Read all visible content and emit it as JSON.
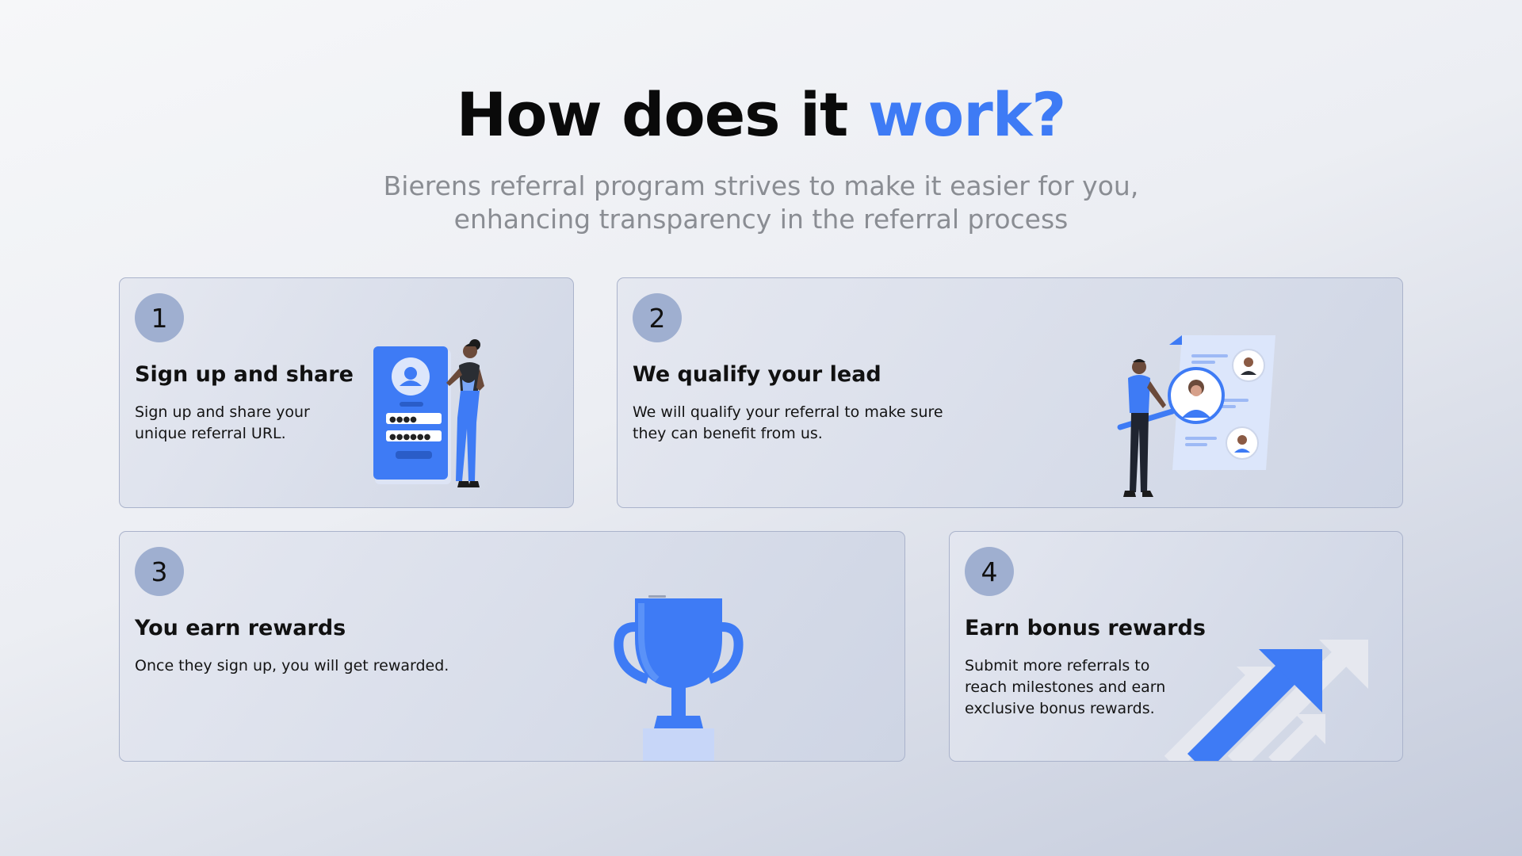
{
  "header": {
    "title_main": "How does it",
    "title_accent": "work?",
    "subtitle_line1": "Bierens referral program strives to make it easier for you,",
    "subtitle_line2": "enhancing transparency in the referral process"
  },
  "steps": [
    {
      "number": "1",
      "title": "Sign up and share",
      "desc_lines": [
        "Sign up and share your",
        "unique referral URL."
      ],
      "illustration": "person-with-signup-form-icon"
    },
    {
      "number": "2",
      "title": "We qualify your lead",
      "desc_lines": [
        "We will qualify your referral to make sure",
        "they can benefit from us."
      ],
      "illustration": "person-with-magnifier-profiles-icon"
    },
    {
      "number": "3",
      "title": "You earn rewards",
      "desc_lines": [
        "Once they sign up, you will get rewarded."
      ],
      "illustration": "trophy-icon"
    },
    {
      "number": "4",
      "title": "Earn bonus rewards",
      "desc_lines": [
        "Submit more referrals to",
        "reach milestones and earn",
        "exclusive bonus rewards."
      ],
      "illustration": "growth-arrows-icon"
    }
  ],
  "colors": {
    "accent": "#3e7bf5",
    "badge": "#9fafd0",
    "subtitle": "#8a8d93"
  }
}
